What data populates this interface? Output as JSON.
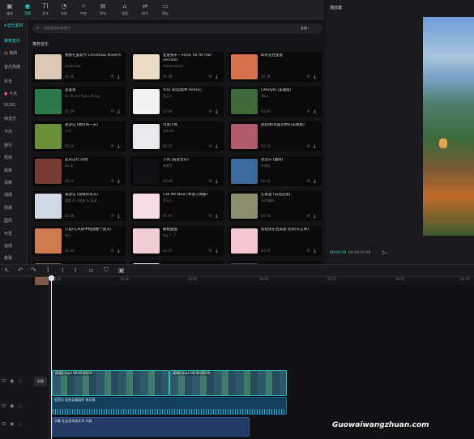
{
  "toolbar": {
    "tools": [
      {
        "label": "媒体",
        "icon": "media-icon"
      },
      {
        "label": "音频",
        "icon": "audio-icon"
      },
      {
        "label": "文本",
        "icon": "text-icon"
      },
      {
        "label": "贴纸",
        "icon": "sticker-icon"
      },
      {
        "label": "特效",
        "icon": "effects-icon"
      },
      {
        "label": "转场",
        "icon": "transition-icon"
      },
      {
        "label": "滤镜",
        "icon": "filter-icon"
      },
      {
        "label": "调节",
        "icon": "adjust-icon"
      },
      {
        "label": "模板",
        "icon": "template-icon"
      }
    ]
  },
  "sidebar": {
    "items": [
      {
        "label": "音乐素材"
      },
      {
        "label": "推荐音乐"
      },
      {
        "label": "我的"
      },
      {
        "label": "音乐热榜"
      },
      {
        "label": "抖音"
      },
      {
        "label": "卡点"
      },
      {
        "label": "VLOG"
      },
      {
        "label": "纯音乐"
      },
      {
        "label": "卡点"
      },
      {
        "label": "旅行"
      },
      {
        "label": "轻快"
      },
      {
        "label": "搞笑"
      },
      {
        "label": "清新"
      },
      {
        "label": "动感"
      },
      {
        "label": "舒缓"
      },
      {
        "label": "国风"
      },
      {
        "label": "可爱"
      },
      {
        "label": "运动"
      },
      {
        "label": "悬疑"
      }
    ]
  },
  "library": {
    "search_placeholder": "搜索歌曲名称/歌手",
    "filter_label": "全部",
    "section_title": "推荐音乐",
    "songs": [
      {
        "title": "我想在圣诞节 Christmas Modern",
        "artist": "Leslie Lee",
        "dur": "02:05",
        "color": "#d9c9b5"
      },
      {
        "title": "圣诞快乐 - Xmas for All (full version)",
        "artist": "Sommsound",
        "dur": "01:38",
        "color": "#eadcc4"
      },
      {
        "title": "如何记住圣诞",
        "artist": "",
        "dur": "02:38",
        "color": "#d6734f"
      },
      {
        "title": "圣诞夜",
        "artist": "Xu Shulai Ryuu Xiong",
        "dur": "02:39",
        "color": "#2c7a4a"
      },
      {
        "title": "YOU (初恋版本 Remix)",
        "artist": "音乐人",
        "dur": "02:48",
        "color": "#f2f2f2"
      },
      {
        "title": "Lifestyle (美丽版)",
        "artist": "Tobu",
        "dur": "03:29",
        "color": "#3e6a3b"
      },
      {
        "title": "夜游记 (我好的一天)",
        "artist": "小可",
        "dur": "02:24",
        "color": "#6b8e3a"
      },
      {
        "title": "可爱小熊",
        "artist": "Sylvain",
        "dur": "02:19",
        "color": "#e9e9ec"
      },
      {
        "title": "轻轻地(早晨)(你好(前奏版)",
        "artist": "",
        "dur": "02:51",
        "color": "#b05a6b"
      },
      {
        "title": "是日己行 的情",
        "artist": "Ba 木",
        "dur": "02:21",
        "color": "#7a3b35"
      },
      {
        "title": "小风 (成说音乐)",
        "artist": "新歌手",
        "dur": "03:18",
        "color": "#111114"
      },
      {
        "title": "轻音乐 (烟雨)",
        "artist": "小朋友",
        "dur": "02:41",
        "color": "#3c6a9c"
      },
      {
        "title": "夜游记 (夜晚的冬天)",
        "artist": "晨晨 & 小朋友 & 某某",
        "dur": "02:06",
        "color": "#cfd8e3"
      },
      {
        "title": "Call Me Now (粤语小调版)",
        "artist": "音乐人",
        "dur": "01:41",
        "color": "#f6dfe6"
      },
      {
        "title": "在雨里 (未选定版)",
        "artist": "乐坊清新",
        "dur": "02:18",
        "color": "#8d8d70"
      },
      {
        "title": "只是(在风雨中相遇整个夏天)",
        "artist": "旅人",
        "dur": "02:34",
        "color": "#d07a4f"
      },
      {
        "title": "樱桃甜甜",
        "artist": "Kaj 人 了",
        "dur": "02:27",
        "color": "#f2cfd4"
      },
      {
        "title": "轻轻快乐且美丽 轻快(有言本)",
        "artist": "",
        "dur": "02:37",
        "color": "#f4c7d2"
      },
      {
        "title": "",
        "artist": "",
        "dur": "",
        "color": "#7c5a4a"
      },
      {
        "title": "",
        "artist": "",
        "dur": "",
        "color": "#d6dbe4"
      },
      {
        "title": "",
        "artist": "",
        "dur": "",
        "color": "#4f4f56"
      }
    ]
  },
  "player": {
    "title": "播放器",
    "time_current": "00:00:00",
    "time_total": "00:00:10:06"
  },
  "timeline": {
    "ruler": [
      "00:00",
      "10:00",
      "20:00",
      "00:10",
      "00:12",
      "00:15",
      "00:18"
    ],
    "cover_label": "封面",
    "video_clip_1": "视频1.mp4  00:00:05:00",
    "video_clip_2": "视频2.mp4  00:00:05:00",
    "audio_clip": "轻音乐  轻快且美丽的 快乐版",
    "subtitle_clip": "字幕  在这里添加文字  内容"
  },
  "watermark": "Guowaiwangzhuan.com"
}
